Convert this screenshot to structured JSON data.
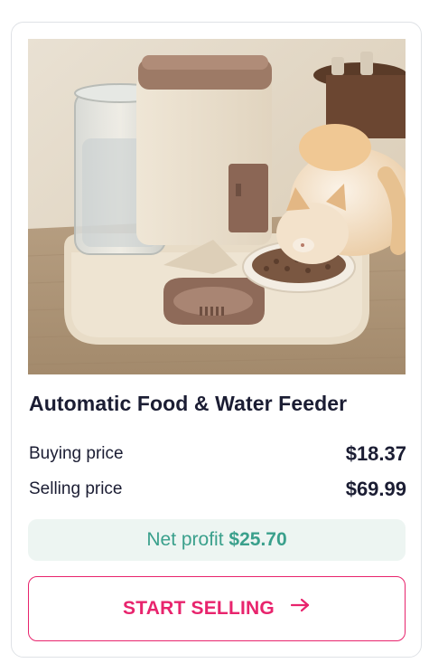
{
  "product": {
    "image_alt": "Automatic pet food and water feeder with cat eating",
    "title": "Automatic Food & Water Feeder"
  },
  "pricing": {
    "buying_label": "Buying price",
    "buying_value": "$18.37",
    "selling_label": "Selling price",
    "selling_value": "$69.99",
    "profit_label": "Net profit",
    "profit_value": "$25.70"
  },
  "actions": {
    "start_selling_label": "START SELLING",
    "arrow_icon": "arrow-right-icon"
  },
  "colors": {
    "accent": "#e8246d",
    "profit_text": "#3aa08c",
    "profit_bg": "#edf5f2",
    "title_text": "#1b1d33"
  }
}
